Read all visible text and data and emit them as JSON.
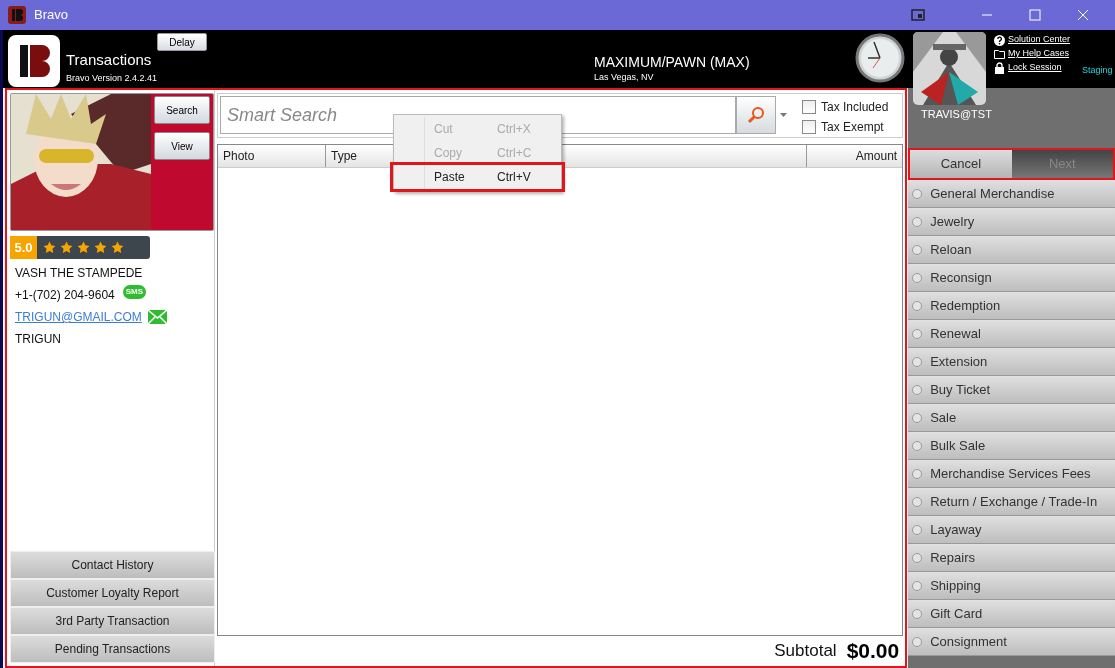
{
  "window": {
    "title": "Bravo"
  },
  "header": {
    "app_title": "Transactions",
    "version": "Bravo Version 2.4.2.41",
    "delay_button": "Delay",
    "store_name": "MAXIMUM/PAWN (MAX)",
    "store_location": "Las Vegas, NV",
    "user": "TRAVIS@TST",
    "environment": "Staging",
    "links": [
      {
        "kind": "help",
        "label": "Solution Center"
      },
      {
        "kind": "folder",
        "label": "My Help Cases"
      },
      {
        "kind": "lock",
        "label": "Lock Session"
      }
    ]
  },
  "customer": {
    "buttons": [
      "Search",
      "View"
    ],
    "rating": "5.0",
    "stars": 5,
    "name": "VASH THE STAMPEDE",
    "phone": "+1-(702) 204-9604",
    "sms_badge": "SMS",
    "email": "TRIGUN@GMAIL.COM",
    "note": "TRIGUN",
    "actions": [
      "Contact History",
      "Customer Loyalty Report",
      "3rd Party Transaction",
      "Pending Transactions"
    ]
  },
  "search": {
    "placeholder": "Smart Search",
    "options": [
      {
        "label": "Tax Included",
        "checked": false
      },
      {
        "label": "Tax Exempt",
        "checked": false
      }
    ]
  },
  "table": {
    "columns": [
      "Photo",
      "Type",
      "Amount"
    ]
  },
  "context_menu": [
    {
      "label": "Cut",
      "shortcut": "Ctrl+X",
      "disabled": true,
      "selected": false
    },
    {
      "label": "Copy",
      "shortcut": "Ctrl+C",
      "disabled": true,
      "selected": false
    },
    {
      "label": "Paste",
      "shortcut": "Ctrl+V",
      "disabled": false,
      "selected": true
    }
  ],
  "subtotal": {
    "label": "Subtotal",
    "value": "$0.00"
  },
  "nav": [
    {
      "label": "Cancel",
      "disabled": false
    },
    {
      "label": "Next",
      "disabled": true
    }
  ],
  "transaction_types": [
    "General Merchandise",
    "Jewelry",
    "Reloan",
    "Reconsign",
    "Redemption",
    "Renewal",
    "Extension",
    "Buy Ticket",
    "Sale",
    "Bulk Sale",
    "Merchandise Services Fees",
    "Return / Exchange / Trade-In",
    "Layaway",
    "Repairs",
    "Shipping",
    "Gift Card",
    "Consignment"
  ]
}
